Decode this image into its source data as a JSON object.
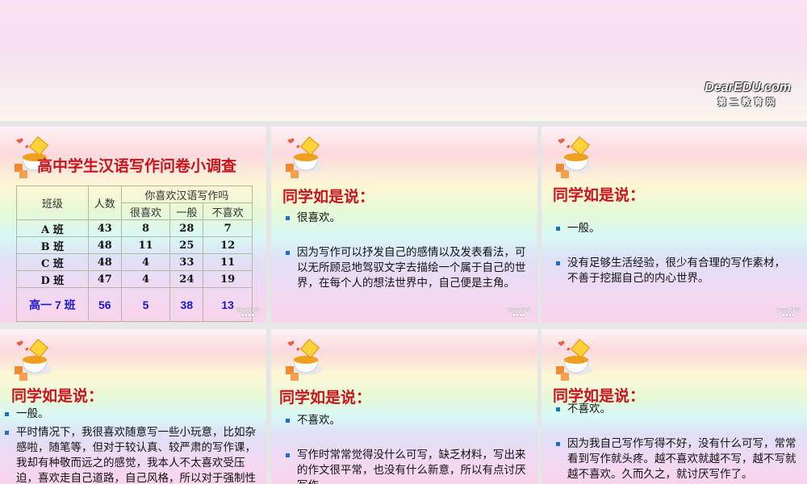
{
  "header": {
    "logo_text": "DearEDU.com",
    "logo_sub": "第二教育网"
  },
  "survey": {
    "title": "高中学生汉语写作问卷小调查",
    "headers": {
      "class": "班级",
      "count": "人数",
      "question": "你喜欢汉语写作吗",
      "like": "很喜欢",
      "neutral": "一般",
      "dislike": "不喜欢"
    },
    "rows": [
      {
        "class": "A 班",
        "count": "43",
        "like": "8",
        "neutral": "28",
        "dislike": "7"
      },
      {
        "class": "B 班",
        "count": "48",
        "like": "11",
        "neutral": "25",
        "dislike": "12"
      },
      {
        "class": "C 班",
        "count": "48",
        "like": "4",
        "neutral": "33",
        "dislike": "11"
      },
      {
        "class": "D 班",
        "count": "47",
        "like": "4",
        "neutral": "24",
        "dislike": "19"
      },
      {
        "class": "高一 7 班",
        "count": "56",
        "like": "5",
        "neutral": "38",
        "dislike": "13"
      }
    ]
  },
  "slides": [
    {
      "title": "同学如是说：",
      "items": [
        "很喜欢。",
        "因为写作可以抒发自己的感情以及发表看法，可以无所顾忌地驾驭文字去描绘一个属于自己的世界，在每个人的想法世界中，自己便是主角。"
      ]
    },
    {
      "title": "同学如是说：",
      "items": [
        "一般。",
        "没有足够生活经验，很少有合理的写作素材，不善于挖掘自己的内心世界。"
      ]
    },
    {
      "title": "同学如是说：",
      "items": [
        "一般。",
        "平时情况下，我很喜欢随意写一些小玩意，比如杂感啦，随笔等，但对于较认真、较严肃的写作课，我却有种敬而远之的感觉，我本人不太喜欢受压迫，喜欢走自己道路，自己风格，所以对于强制性的写作感到头疼，而在"
      ]
    },
    {
      "title": "同学如是说：",
      "items": [
        "不喜欢。",
        "写作时常常觉得没什么可写，缺乏材料，写出来的作文很平常，也没有什么新意，所以有点讨厌写作。"
      ]
    },
    {
      "title": "同学如是说：",
      "items": [
        "不喜欢。",
        "因为我自己写作写得不好，没有什么可写，常常看到写作就头疼。越不喜欢就越不写，越不写就越不喜欢。久而久之，就讨厌写作了。"
      ]
    }
  ]
}
